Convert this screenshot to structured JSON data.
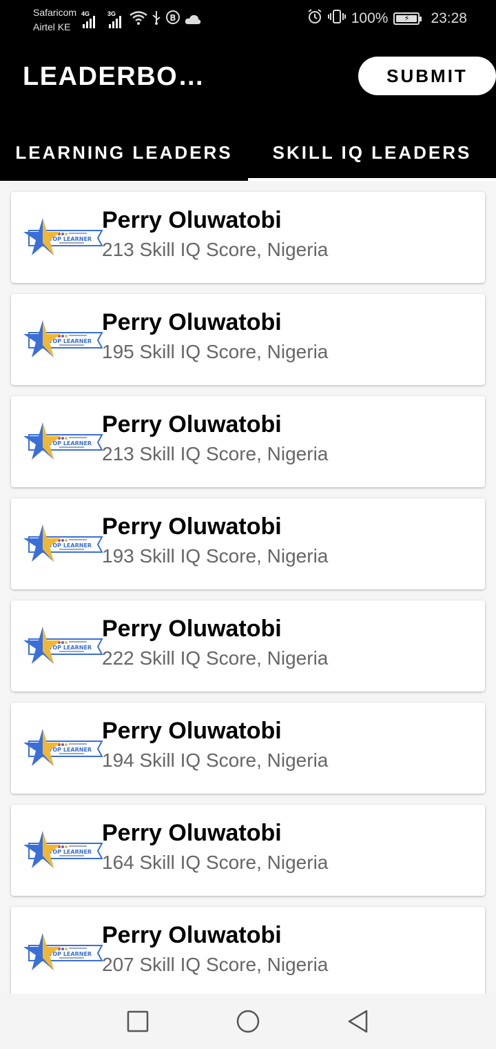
{
  "status_bar": {
    "carrier_1": "Safaricom",
    "carrier_2": "Airtel KE",
    "net_1": "4G",
    "net_2": "3G",
    "battery": "100%",
    "time": "23:28"
  },
  "app_bar": {
    "title": "LEADERBOARD",
    "submit_label": "SUBMIT"
  },
  "tabs": [
    {
      "label": "LEARNING LEADERS",
      "active": false
    },
    {
      "label": "SKILL IQ LEADERS",
      "active": true
    }
  ],
  "badge": {
    "text": "TOP LEARNER",
    "star_color": "#f0b832",
    "star_shade": "#3a6fd8"
  },
  "leaders": [
    {
      "name": "Perry Oluwatobi",
      "detail": "213 Skill IQ Score, Nigeria"
    },
    {
      "name": "Perry Oluwatobi",
      "detail": "195 Skill IQ Score, Nigeria"
    },
    {
      "name": "Perry Oluwatobi",
      "detail": "213 Skill IQ Score, Nigeria"
    },
    {
      "name": "Perry Oluwatobi",
      "detail": "193 Skill IQ Score, Nigeria"
    },
    {
      "name": "Perry Oluwatobi",
      "detail": "222 Skill IQ Score, Nigeria"
    },
    {
      "name": "Perry Oluwatobi",
      "detail": "194 Skill IQ Score, Nigeria"
    },
    {
      "name": "Perry Oluwatobi",
      "detail": "164 Skill IQ Score, Nigeria"
    },
    {
      "name": "Perry Oluwatobi",
      "detail": "207 Skill IQ Score, Nigeria"
    }
  ],
  "nav": {
    "recents_icon": "square-icon",
    "home_icon": "circle-icon",
    "back_icon": "triangle-back-icon"
  },
  "colors": {
    "app_bar": "#000000",
    "detail_text": "#666666",
    "badge_blue": "#3a6fd8"
  }
}
